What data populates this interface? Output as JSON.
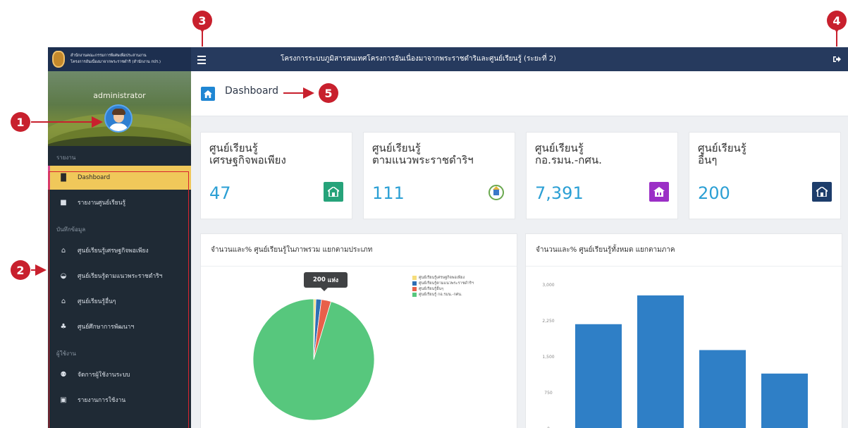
{
  "topbar": {
    "brand_line1": "สำนักงานคณะกรรมการพิเศษเพื่อประสานงาน",
    "brand_line2": "โครงการอันเนื่องมาจากพระราชดำริ (สำนักงาน กปร.)",
    "title": "โครงการระบบภูมิสารสนเทศโครงการอันเนื่องมาจากพระราชดำริและศูนย์เรียนรู้ (ระยะที่ 2)",
    "menu_icon": "hamburger-icon",
    "logout_icon": "logout-icon"
  },
  "profile": {
    "username": "administrator",
    "avatar_icon": "user-avatar"
  },
  "sidebar": {
    "sections": [
      {
        "label": "รายงาน",
        "items": [
          {
            "label": "Dashboard",
            "icon": "bar-chart-icon",
            "active": true
          },
          {
            "label": "รายงานศูนย์เรียนรู้",
            "icon": "file-icon",
            "active": false
          }
        ]
      },
      {
        "label": "บันทึกข้อมูล",
        "items": [
          {
            "label": "ศูนย์เรียนรู้เศรษฐกิจพอเพียง",
            "icon": "house-icon",
            "active": false
          },
          {
            "label": "ศูนย์เรียนรู้ตามแนวพระราชดำริฯ",
            "icon": "emblem-icon",
            "active": false
          },
          {
            "label": "ศูนย์เรียนรู้อื่นๆ",
            "icon": "home-icon",
            "active": false
          },
          {
            "label": "ศูนย์ศึกษาการพัฒนาฯ",
            "icon": "group-icon",
            "active": false
          }
        ]
      },
      {
        "label": "ผู้ใช้งาน",
        "items": [
          {
            "label": "จัดการผู้ใช้งานระบบ",
            "icon": "users-icon",
            "active": false
          },
          {
            "label": "รายงานการใช้งาน",
            "icon": "report-icon",
            "active": false
          }
        ]
      }
    ]
  },
  "page": {
    "title": "Dashboard",
    "home_icon": "home-icon"
  },
  "cards": [
    {
      "title_line1": "ศูนย์เรียนรู้",
      "title_line2": "เศรษฐกิจพอเพียง",
      "value": "47",
      "icon": "house-icon",
      "color": "#26a37a"
    },
    {
      "title_line1": "ศูนย์เรียนรู้",
      "title_line2": "ตามแนวพระราชดำริฯ",
      "value": "111",
      "icon": "emblem-icon",
      "color": "#ffffff"
    },
    {
      "title_line1": "ศูนย์เรียนรู้",
      "title_line2": "กอ.รมน.-กศน.",
      "value": "7,391",
      "icon": "building-icon",
      "color": "#9b2fc6"
    },
    {
      "title_line1": "ศูนย์เรียนรู้",
      "title_line2": "อื่นๆ",
      "value": "200",
      "icon": "home-icon",
      "color": "#1d3d6b"
    }
  ],
  "panels": {
    "pie_title": "จำนวนและ% ศูนย์เรียนรู้ในภาพรวม แยกตามประเภท",
    "bar_title": "จำนวนและ% ศูนย์เรียนรู้ทั้งหมด แยกตามภาค",
    "tooltip_count": "200",
    "tooltip_unit": "แห่ง"
  },
  "chart_data": [
    {
      "type": "pie",
      "title": "จำนวนและ% ศูนย์เรียนรู้ในภาพรวม แยกตามประเภท",
      "categories": [
        "ศูนย์เรียนรู้เศรษฐกิจพอเพียง",
        "ศูนย์เรียนรู้ตามแนวพระราชดำริฯ",
        "ศูนย์เรียนรู้อื่นๆ",
        "ศูนย์เรียนรู้ กอ.รมน.-กศน."
      ],
      "values": [
        47,
        111,
        200,
        7391
      ],
      "colors": [
        "#f5dd7a",
        "#2f6fb5",
        "#e8604a",
        "#57c77d"
      ],
      "legend": "top-right"
    },
    {
      "type": "bar",
      "title": "จำนวนและ% ศูนย์เรียนรู้ทั้งหมด แยกตามภาค",
      "values": [
        2180,
        2780,
        1640,
        1150
      ],
      "ylim": [
        0,
        3000
      ],
      "yticks": [
        "3,000",
        "2,250",
        "1,500",
        "750",
        "0"
      ],
      "color": "#2f7fc6",
      "grid": false
    }
  ],
  "annotations": {
    "markers": [
      "1",
      "2",
      "3",
      "4",
      "5"
    ],
    "color": "#c8202d"
  }
}
